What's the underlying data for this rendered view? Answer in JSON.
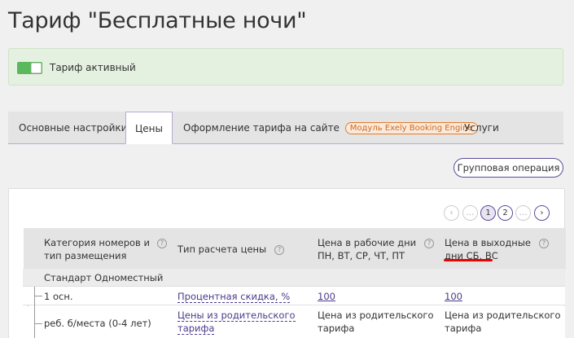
{
  "page": {
    "title": "Тариф \"Бесплатные ночи\""
  },
  "status": {
    "label": "Тариф активный",
    "toggle_on": true,
    "toggle_color": "#5cb85c"
  },
  "tabs": [
    {
      "label": "Основные настройки"
    },
    {
      "label": "Цены"
    },
    {
      "label": "Оформление тарифа на сайте",
      "badge": "Модуль Exely Booking Engine"
    },
    {
      "label": "Услуги"
    }
  ],
  "toolbar": {
    "group_operation": "Групповая операция"
  },
  "pagination": {
    "pages": [
      "1",
      "2"
    ],
    "current": "1",
    "ellipsis": "…"
  },
  "table": {
    "headers": {
      "category_line1": "Категория номеров и",
      "category_line2": "тип размещения",
      "price_type": "Тип расчета цены",
      "weekdays_line1": "Цена в рабочие дни",
      "weekdays_line2": "ПН, ВТ, СР, ЧТ, ПТ",
      "weekend_line1": "Цена в выходные",
      "weekend_prefix": "дни",
      "weekend_days": "СБ, ВС"
    },
    "group": "Стандарт Одноместный",
    "rows": [
      {
        "placement": "1 осн.",
        "price_type": "Процентная скидка, %",
        "weekday": "100",
        "weekend": "100"
      },
      {
        "placement": "реб. б/места (0-4 лет)",
        "price_type_line1": "Цены из родительского",
        "price_type_line2": "тарифа",
        "weekday_line1": "Цена из родительского",
        "weekday_line2": "тарифа",
        "weekend_line1": "Цена из родительского",
        "weekend_line2": "тарифа"
      }
    ]
  },
  "colors": {
    "accent": "#5d4a99",
    "badge": "#e07b2c",
    "highlight_underline": "#e00000"
  }
}
